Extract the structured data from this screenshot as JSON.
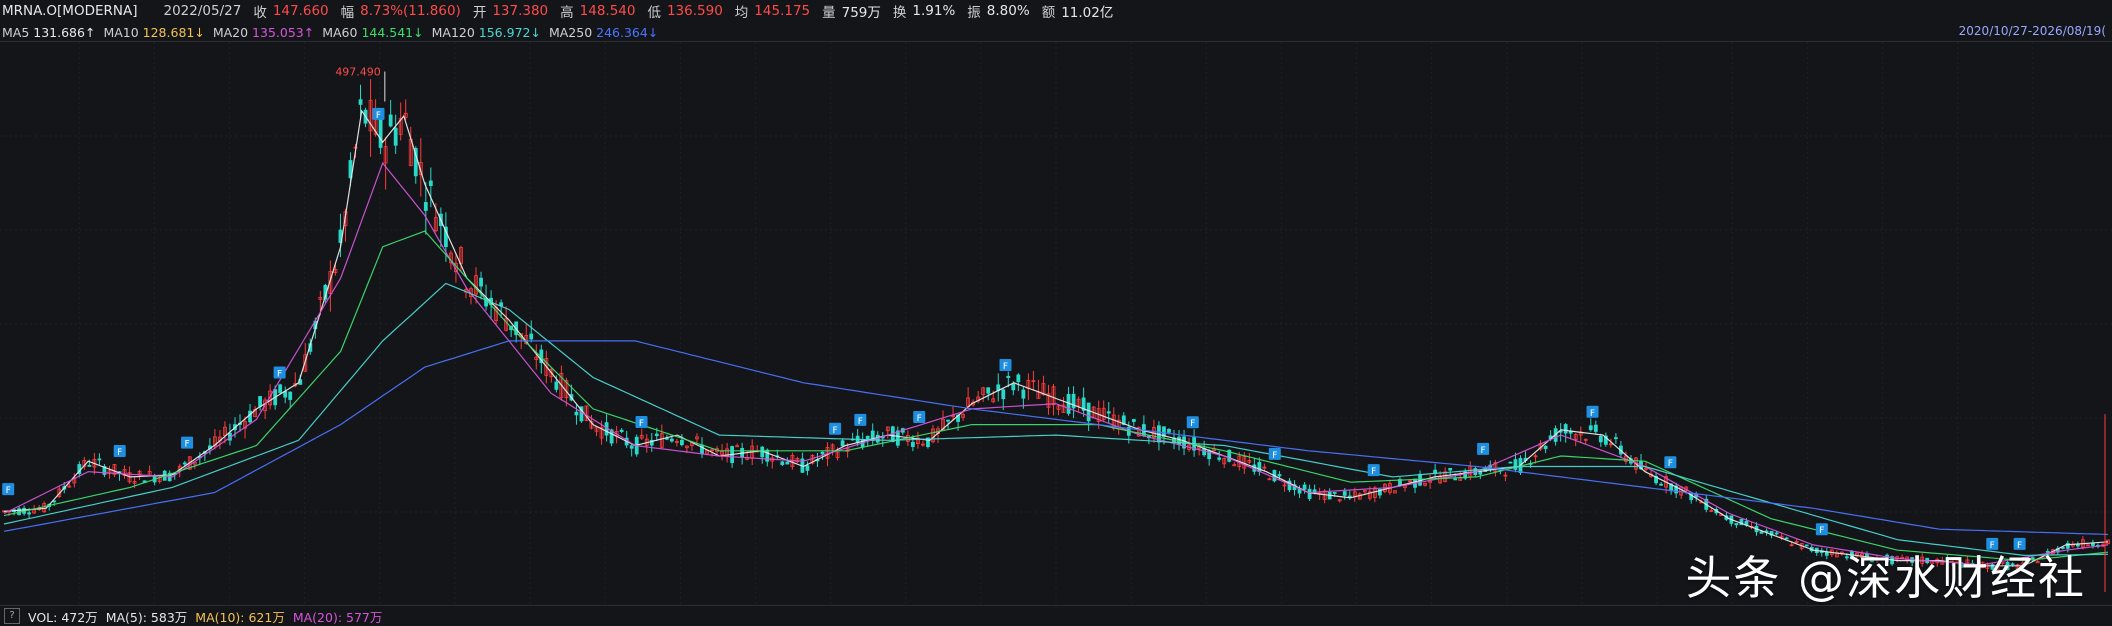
{
  "header": {
    "symbol": "MRNA.O[MODERNA]",
    "date": "2022/05/27",
    "close_label": "收",
    "close_value": "147.660",
    "amp_label": "幅",
    "amp_value": "8.73%(11.860)",
    "open_label": "开",
    "open_value": "137.380",
    "high_label": "高",
    "high_value": "148.540",
    "low_label": "低",
    "low_value": "136.590",
    "avg_label": "均",
    "avg_value": "145.175",
    "vol_label": "量",
    "vol_value": "759万",
    "turnover_label": "换",
    "turnover_value": "1.91%",
    "swing_label": "振",
    "swing_value": "8.80%",
    "amount_label": "额",
    "amount_value": "11.02亿"
  },
  "ma_legend": [
    {
      "label": "MA5",
      "value": "131.686↑",
      "color": "#e8e8e8"
    },
    {
      "label": "MA10",
      "value": "128.681↓",
      "color": "#f2c14e"
    },
    {
      "label": "MA20",
      "value": "135.053↑",
      "color": "#d455d8"
    },
    {
      "label": "MA60",
      "value": "144.541↓",
      "color": "#3ddc6b"
    },
    {
      "label": "MA120",
      "value": "156.972↓",
      "color": "#4ad7d1"
    },
    {
      "label": "MA250",
      "value": "246.364↓",
      "color": "#4b74ff"
    }
  ],
  "date_range": "2020/10/27-2026/08/19(",
  "peak_label": "497.490",
  "volume_bar": {
    "q": "?",
    "vol": "VOL: 472万",
    "ma5": "MA(5): 583万",
    "ma10": "MA(10): 621万",
    "ma20": "MA(20): 577万",
    "ma5_color": "#e8e8e8",
    "ma10_color": "#f2c14e",
    "ma20_color": "#d455d8"
  },
  "watermark": "头条 @深水财经社",
  "marker_text": "F",
  "chart_data": {
    "type": "line",
    "title": "",
    "xlabel": "",
    "ylabel": "",
    "x_range": [
      "2020/10/27",
      "2026/08/19"
    ],
    "ylim": [
      0,
      520
    ],
    "grid": true,
    "series": [
      {
        "name": "MA5",
        "color": "#e8e8e8",
        "points": [
          [
            0,
            77
          ],
          [
            2,
            80
          ],
          [
            4,
            125
          ],
          [
            6,
            110
          ],
          [
            8,
            112
          ],
          [
            10,
            140
          ],
          [
            12,
            175
          ],
          [
            14,
            200
          ],
          [
            16,
            330
          ],
          [
            17,
            460
          ],
          [
            18,
            430
          ],
          [
            19,
            455
          ],
          [
            20,
            390
          ],
          [
            22,
            300
          ],
          [
            24,
            260
          ],
          [
            26,
            210
          ],
          [
            28,
            160
          ],
          [
            30,
            140
          ],
          [
            32,
            150
          ],
          [
            34,
            130
          ],
          [
            36,
            135
          ],
          [
            38,
            120
          ],
          [
            40,
            140
          ],
          [
            42,
            150
          ],
          [
            44,
            145
          ],
          [
            46,
            180
          ],
          [
            48,
            200
          ],
          [
            50,
            185
          ],
          [
            52,
            170
          ],
          [
            54,
            155
          ],
          [
            56,
            145
          ],
          [
            58,
            130
          ],
          [
            60,
            115
          ],
          [
            62,
            95
          ],
          [
            64,
            90
          ],
          [
            66,
            100
          ],
          [
            68,
            110
          ],
          [
            70,
            115
          ],
          [
            72,
            120
          ],
          [
            74,
            155
          ],
          [
            76,
            150
          ],
          [
            78,
            115
          ],
          [
            80,
            95
          ],
          [
            82,
            70
          ],
          [
            84,
            55
          ],
          [
            86,
            40
          ],
          [
            88,
            35
          ],
          [
            90,
            30
          ],
          [
            92,
            30
          ],
          [
            94,
            25
          ],
          [
            96,
            25
          ],
          [
            98,
            45
          ],
          [
            100,
            48
          ]
        ]
      },
      {
        "name": "MA20",
        "color": "#d455d8",
        "points": [
          [
            0,
            75
          ],
          [
            4,
            115
          ],
          [
            8,
            110
          ],
          [
            12,
            165
          ],
          [
            16,
            300
          ],
          [
            18,
            410
          ],
          [
            20,
            360
          ],
          [
            22,
            290
          ],
          [
            26,
            190
          ],
          [
            30,
            140
          ],
          [
            34,
            130
          ],
          [
            38,
            125
          ],
          [
            42,
            150
          ],
          [
            46,
            175
          ],
          [
            50,
            180
          ],
          [
            54,
            150
          ],
          [
            58,
            130
          ],
          [
            62,
            95
          ],
          [
            66,
            100
          ],
          [
            70,
            115
          ],
          [
            74,
            150
          ],
          [
            78,
            120
          ],
          [
            82,
            75
          ],
          [
            86,
            45
          ],
          [
            90,
            32
          ],
          [
            94,
            26
          ],
          [
            98,
            40
          ],
          [
            100,
            45
          ]
        ]
      },
      {
        "name": "MA60",
        "color": "#3ddc6b",
        "points": [
          [
            0,
            73
          ],
          [
            6,
            100
          ],
          [
            12,
            140
          ],
          [
            16,
            230
          ],
          [
            18,
            330
          ],
          [
            20,
            345
          ],
          [
            24,
            255
          ],
          [
            28,
            175
          ],
          [
            34,
            135
          ],
          [
            40,
            135
          ],
          [
            46,
            160
          ],
          [
            52,
            160
          ],
          [
            58,
            135
          ],
          [
            64,
            105
          ],
          [
            70,
            110
          ],
          [
            74,
            130
          ],
          [
            78,
            125
          ],
          [
            84,
            70
          ],
          [
            90,
            40
          ],
          [
            96,
            30
          ],
          [
            100,
            38
          ]
        ]
      },
      {
        "name": "MA120",
        "color": "#4ad7d1",
        "points": [
          [
            0,
            65
          ],
          [
            8,
            100
          ],
          [
            14,
            145
          ],
          [
            18,
            240
          ],
          [
            21,
            295
          ],
          [
            24,
            270
          ],
          [
            28,
            205
          ],
          [
            34,
            150
          ],
          [
            42,
            145
          ],
          [
            50,
            150
          ],
          [
            58,
            140
          ],
          [
            66,
            110
          ],
          [
            72,
            120
          ],
          [
            78,
            120
          ],
          [
            84,
            85
          ],
          [
            90,
            50
          ],
          [
            96,
            35
          ],
          [
            100,
            36
          ]
        ]
      },
      {
        "name": "MA250",
        "color": "#4b74ff",
        "points": [
          [
            0,
            58
          ],
          [
            10,
            95
          ],
          [
            16,
            160
          ],
          [
            20,
            215
          ],
          [
            24,
            240
          ],
          [
            30,
            240
          ],
          [
            38,
            200
          ],
          [
            46,
            175
          ],
          [
            54,
            155
          ],
          [
            62,
            135
          ],
          [
            70,
            120
          ],
          [
            78,
            100
          ],
          [
            86,
            80
          ],
          [
            92,
            60
          ],
          [
            100,
            55
          ]
        ]
      }
    ],
    "candle_markers_x": [
      0.2,
      5.5,
      8.7,
      13.1,
      17.8,
      30.3,
      39.5,
      40.7,
      43.5,
      47.6,
      56.5,
      60.4,
      65.1,
      70.3,
      75.5,
      79.2,
      86.4,
      94.5,
      95.8
    ]
  }
}
